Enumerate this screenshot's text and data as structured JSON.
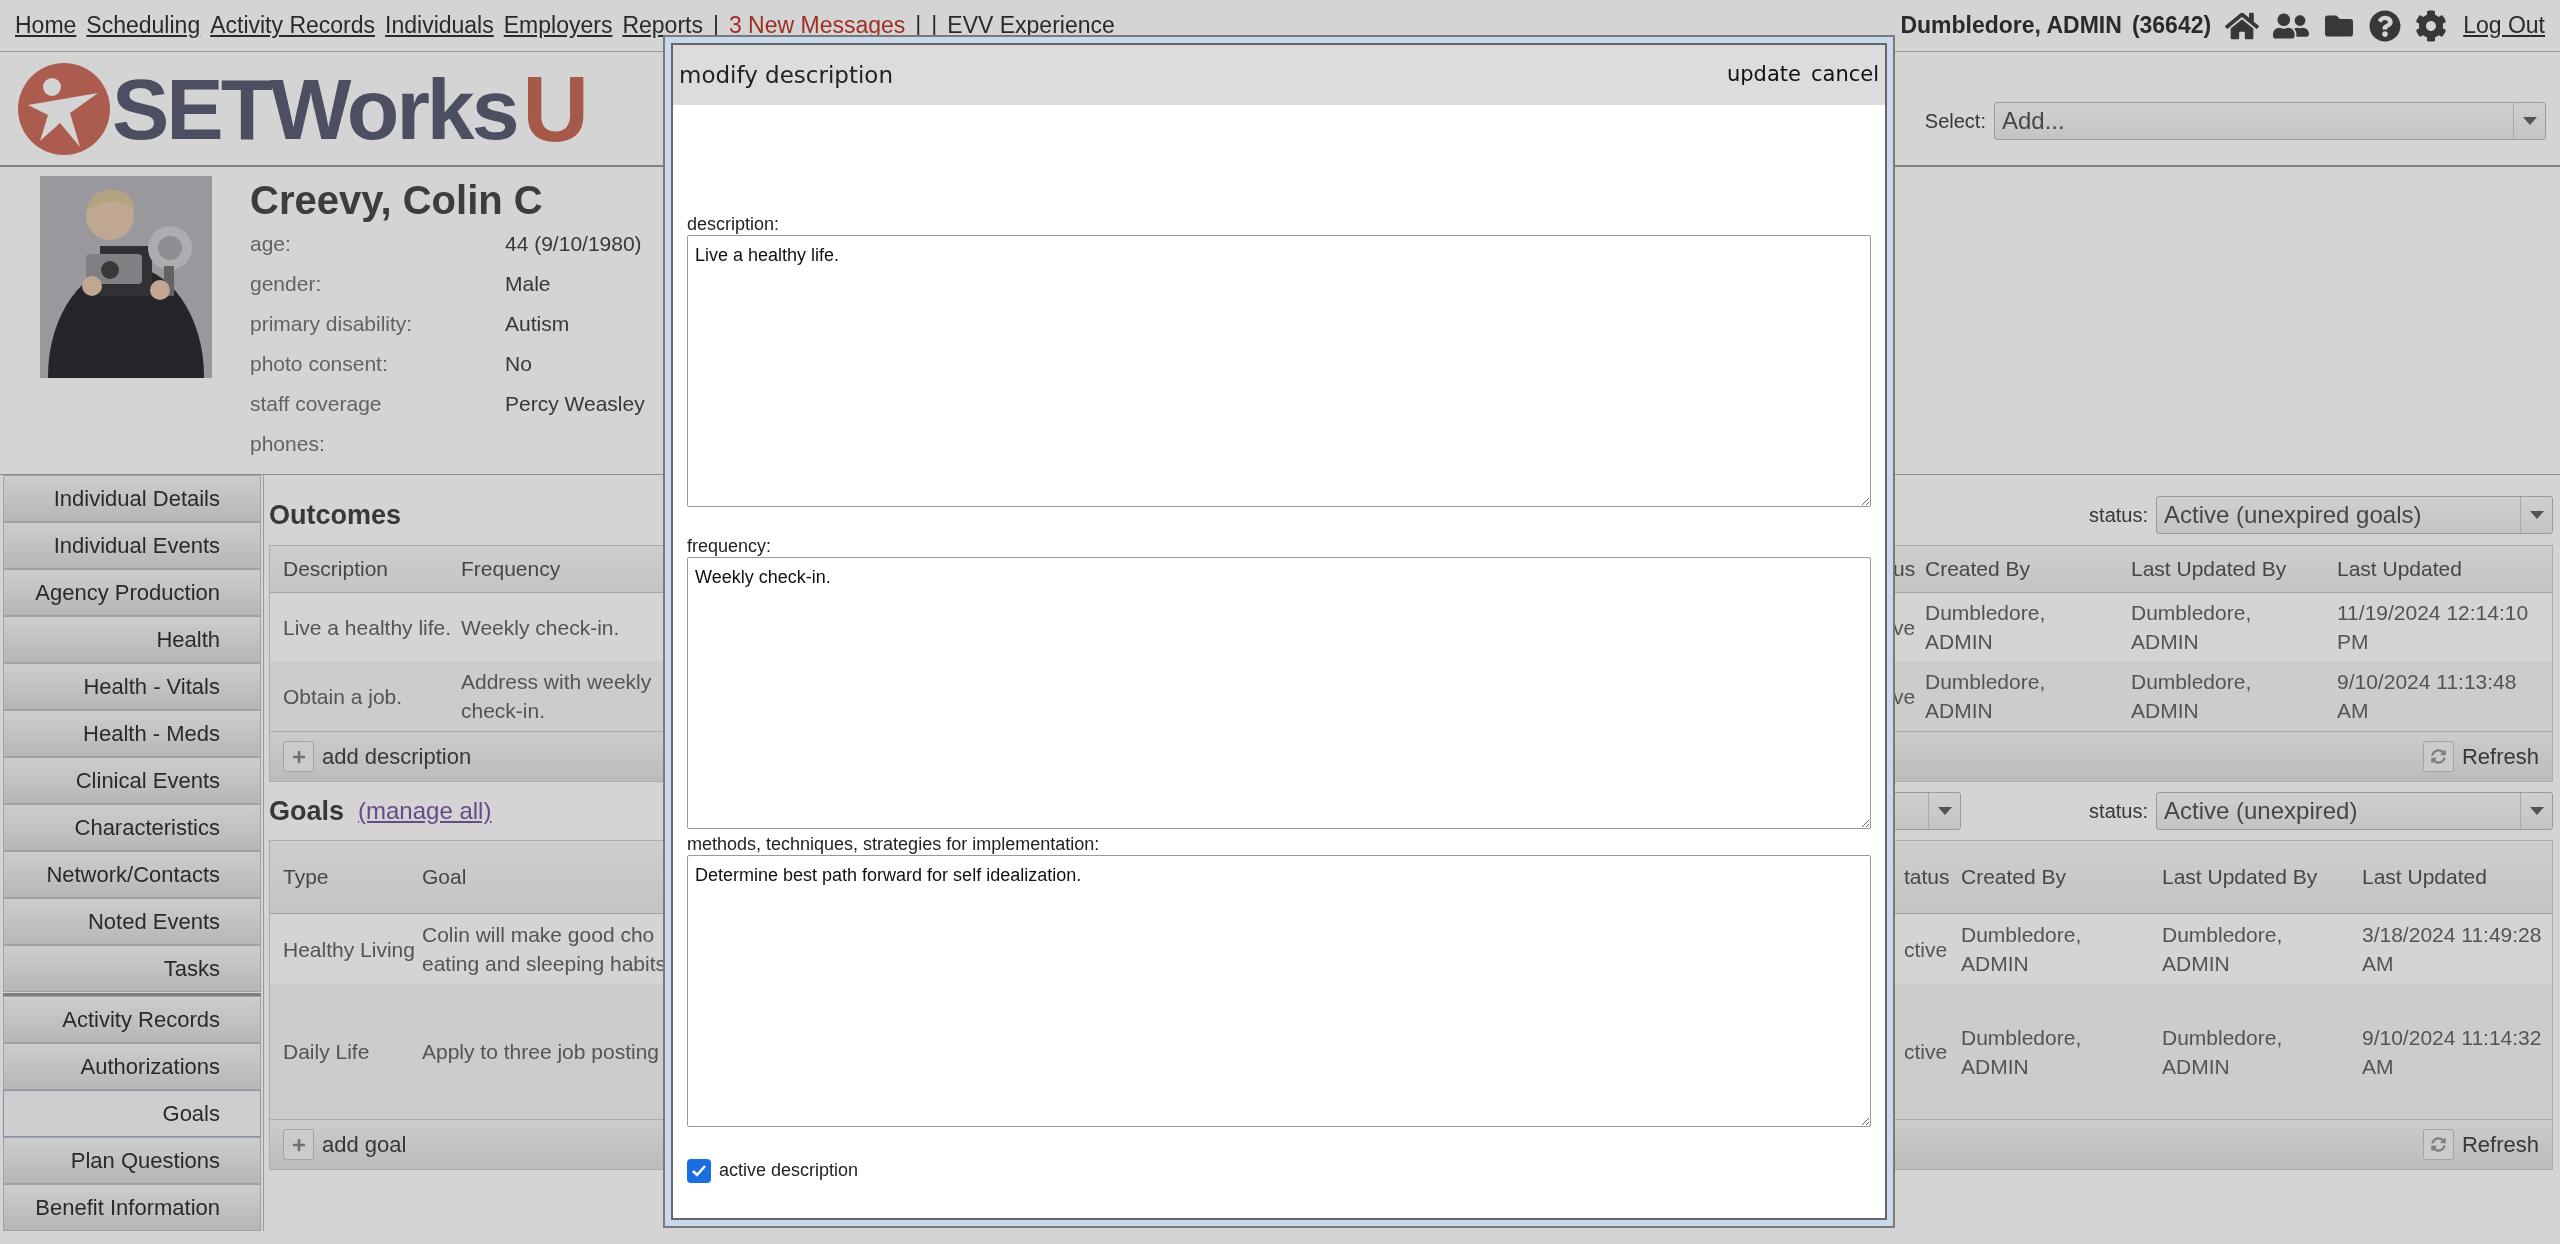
{
  "nav": {
    "items": [
      {
        "label": "Home",
        "kind": "link"
      },
      {
        "label": "Scheduling",
        "kind": "link"
      },
      {
        "label": "Activity Records",
        "kind": "link"
      },
      {
        "label": "Individuals",
        "kind": "link"
      },
      {
        "label": "Employers",
        "kind": "link"
      },
      {
        "label": "Reports",
        "kind": "link"
      },
      {
        "label": "|",
        "kind": "separator"
      },
      {
        "label": "3 New Messages",
        "kind": "alert"
      },
      {
        "label": "|",
        "kind": "separator"
      },
      {
        "label": "|",
        "kind": "separator"
      },
      {
        "label": "EVV Experience",
        "kind": "link"
      }
    ],
    "user": "Dumbledore, ADMIN",
    "user_id": "(36642)",
    "logout": "Log Out"
  },
  "logo": {
    "text": "SETWorks",
    "badge": "U"
  },
  "header_select": {
    "label": "Select:",
    "value": "Add..."
  },
  "profile": {
    "name": "Creevy, Colin C",
    "fields": [
      {
        "label": "age:",
        "value": "44 (9/10/1980)"
      },
      {
        "label": "gender:",
        "value": "Male"
      },
      {
        "label": "primary disability:",
        "value": "Autism"
      },
      {
        "label": "photo consent:",
        "value": "No"
      },
      {
        "label": "staff coverage",
        "value": "Percy Weasley"
      },
      {
        "label": "phones:"
      }
    ]
  },
  "sidebar": {
    "groups": [
      [
        {
          "label": "Individual Details",
          "selected": false
        },
        {
          "label": "Individual Events",
          "selected": false
        },
        {
          "label": "Agency Production",
          "selected": false
        },
        {
          "label": "Health",
          "selected": false
        },
        {
          "label": "Health - Vitals",
          "selected": false
        },
        {
          "label": "Health - Meds",
          "selected": false
        },
        {
          "label": "Clinical Events",
          "selected": false
        },
        {
          "label": "Characteristics",
          "selected": false
        },
        {
          "label": "Network/Contacts",
          "selected": false
        },
        {
          "label": "Noted Events",
          "selected": false
        },
        {
          "label": "Tasks",
          "selected": false
        }
      ],
      [
        {
          "label": "Activity Records",
          "selected": false
        },
        {
          "label": "Authorizations",
          "selected": false
        },
        {
          "label": "Goals",
          "selected": true
        },
        {
          "label": "Plan Questions",
          "selected": false
        },
        {
          "label": "Benefit Information",
          "selected": false
        }
      ]
    ]
  },
  "outcomes": {
    "title": "Outcomes",
    "status": {
      "label": "status:",
      "value": "Active (unexpired goals)"
    },
    "columns": [
      "Description",
      "Frequency",
      "us",
      "Created By",
      "Last Updated By",
      "Last Updated"
    ],
    "rows": [
      [
        "Live a healthy life.",
        "Weekly check-in.",
        "ve",
        "Dumbledore, ADMIN",
        "Dumbledore, ADMIN",
        "11/19/2024 12:14:10 PM"
      ],
      [
        "Obtain a job.",
        "Address with weekly check-in.",
        "ve",
        "Dumbledore, ADMIN",
        "Dumbledore, ADMIN",
        "9/10/2024 11:13:48 AM"
      ]
    ],
    "add_label": "add description",
    "refresh": "Refresh"
  },
  "goals": {
    "title": "Goals",
    "link": "(manage all)",
    "status": {
      "label": "status:",
      "value": "Active (unexpired)"
    },
    "columns": [
      "Type",
      "Goal",
      "tatus",
      "Created By",
      "Last Updated By",
      "Last Updated"
    ],
    "rows": [
      [
        "Healthy Living",
        "Colin will make good cho eating and sleeping habits",
        "ctive",
        "Dumbledore, ADMIN",
        "Dumbledore, ADMIN",
        "3/18/2024 11:49:28 AM"
      ],
      [
        "Daily Life",
        "Apply to three job posting",
        "ctive",
        "Dumbledore, ADMIN",
        "Dumbledore, ADMIN",
        "9/10/2024 11:14:32 AM"
      ]
    ],
    "add_label": "add goal",
    "refresh": "Refresh"
  },
  "modal": {
    "title": "modify description",
    "actions": [
      "update",
      "cancel"
    ],
    "fields": [
      {
        "label": "description:",
        "value": "Live a healthy life."
      },
      {
        "label": "frequency:",
        "value": "Weekly check-in."
      },
      {
        "label": "methods, techniques, strategies for implementation:",
        "value": "Determine best path forward for self idealization."
      }
    ],
    "active": {
      "label": "active description",
      "checked": true
    }
  }
}
